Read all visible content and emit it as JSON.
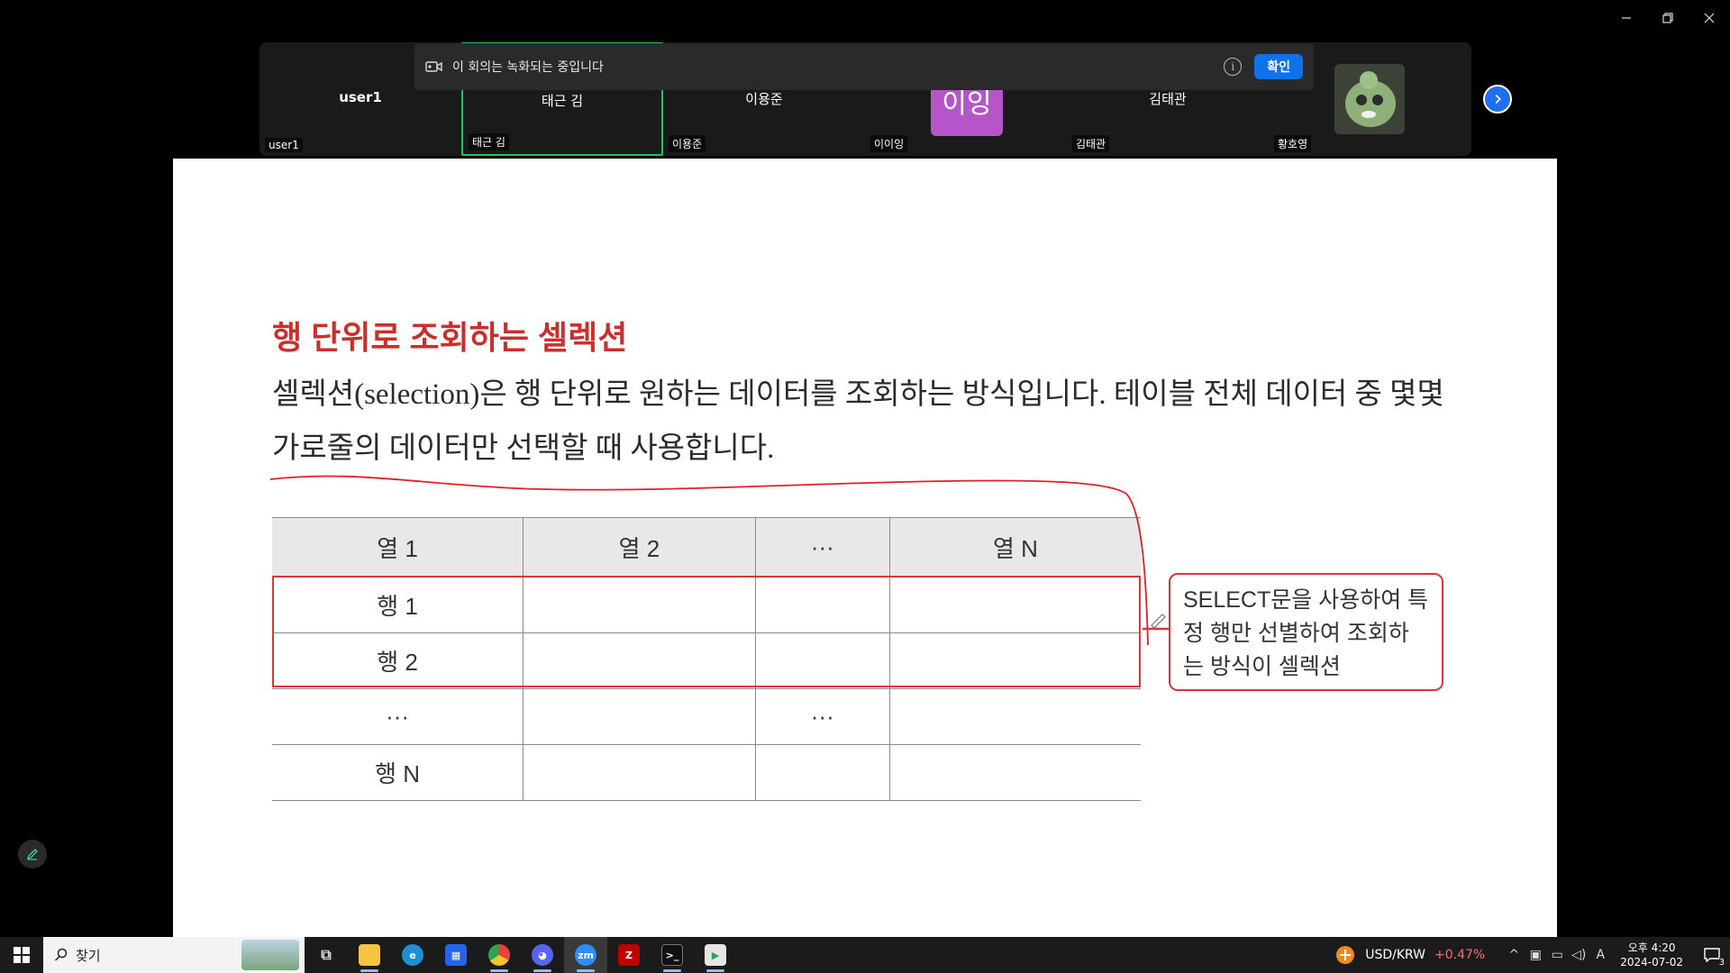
{
  "window": {
    "minimize": "─",
    "restore": "❐",
    "close": "✕"
  },
  "participants": [
    {
      "center_name": "user1",
      "bottom_name": "user1"
    },
    {
      "center_name": "태근 김",
      "bottom_name": "태근 김"
    },
    {
      "center_name": "이용준",
      "bottom_name": "이용준"
    },
    {
      "center_name": "",
      "bottom_name": "이이잉",
      "avatar_text": "이잉"
    },
    {
      "center_name": "김태관",
      "bottom_name": "김태관"
    },
    {
      "center_name": "",
      "bottom_name": "황호영"
    }
  ],
  "banner": {
    "text": "이 회의는 녹화되는 중입니다",
    "info": "i",
    "confirm": "확인"
  },
  "slide": {
    "title": "행 단위로 조회하는 셀렉션",
    "body": "셀렉션(selection)은 행 단위로 원하는 데이터를 조회하는 방식입니다. 테이블 전체 데이터 중 몇몇 가로줄의 데이터만 선택할 때 사용합니다.",
    "table": {
      "headers": [
        "열 1",
        "열 2",
        "···",
        "열 N"
      ],
      "rows": [
        [
          "행 1",
          "",
          "",
          ""
        ],
        [
          "행 2",
          "",
          "",
          ""
        ],
        [
          "···",
          "",
          "···",
          ""
        ],
        [
          "행 N",
          "",
          "",
          ""
        ]
      ]
    },
    "callout": "SELECT문을 사용하여 특정 행만 선별하여 조회하는 방식이 셀렉션"
  },
  "taskbar": {
    "search_placeholder": "찾기",
    "apps": [
      {
        "name": "task-view",
        "glyph": "⧉",
        "color": "#1b1b1b"
      },
      {
        "name": "file-explorer",
        "glyph": "",
        "color": "#f5c542"
      },
      {
        "name": "edge",
        "glyph": "e",
        "color": "#1e8fd6"
      },
      {
        "name": "store",
        "glyph": "▦",
        "color": "#2563eb"
      },
      {
        "name": "chrome",
        "glyph": "●",
        "color": "#e4443a"
      },
      {
        "name": "discord",
        "glyph": "◕",
        "color": "#5865f2"
      },
      {
        "name": "zoom",
        "glyph": "zm",
        "color": "#2d8cff"
      },
      {
        "name": "filezilla",
        "glyph": "Z",
        "color": "#bf0000"
      },
      {
        "name": "terminal",
        "glyph": ">_",
        "color": "#111"
      },
      {
        "name": "media",
        "glyph": "▶",
        "color": "#2e9e5b"
      }
    ],
    "fx_pair": "USD/KRW",
    "fx_change": "+0.47%",
    "ime": "A",
    "time": "오후 4:20",
    "date": "2024-07-02",
    "notifications": "3"
  }
}
